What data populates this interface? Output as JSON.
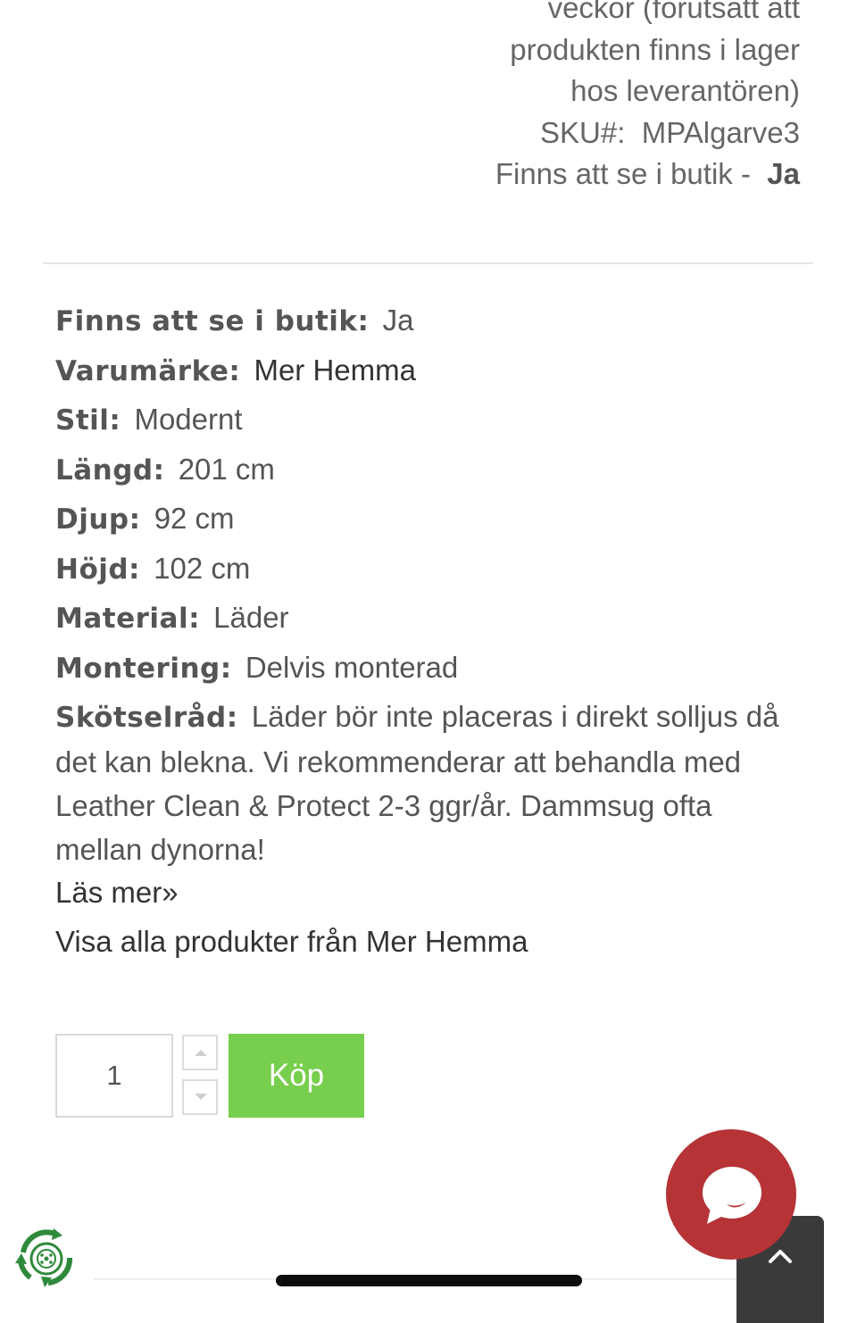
{
  "top_info": {
    "line1": "veckor (förutsatt att",
    "line2": "produkten finns i lager",
    "line3": "hos leverantören)",
    "sku_label": "SKU#:",
    "sku_value": "MPAlgarve3",
    "store_label": "Finns att se i butik -",
    "store_value": "Ja"
  },
  "specs": [
    {
      "label": "Finns att se i butik:",
      "value": "Ja"
    },
    {
      "label": "Varumärke:",
      "value": "Mer Hemma"
    },
    {
      "label": "Stil:",
      "value": "Modernt"
    },
    {
      "label": "Längd:",
      "value": "201 cm"
    },
    {
      "label": "Djup:",
      "value": "92 cm"
    },
    {
      "label": "Höjd:",
      "value": "102 cm"
    },
    {
      "label": "Material:",
      "value": "Läder"
    },
    {
      "label": "Montering:",
      "value": "Delvis monterad"
    }
  ],
  "care": {
    "label": "Skötselråd:",
    "value": "Läder bör inte placeras i direkt solljus då det kan blekna. Vi rekommenderar att behandla med Leather Clean & Protect 2-3 ggr/år. Dammsug ofta mellan dynorna!"
  },
  "links": {
    "read_more": "Läs mer»",
    "all_products": "Visa alla produkter från Mer Hemma"
  },
  "purchase": {
    "quantity": "1",
    "buy_label": "Köp"
  },
  "icons": {
    "stepper_up": "triangle-up-icon",
    "stepper_down": "triangle-down-icon",
    "chat": "chat-bubble-icon",
    "scroll_top": "chevron-up-icon",
    "recycle": "recycle-badge-icon"
  },
  "colors": {
    "buy_button": "#77cf4d",
    "chat_button": "#b63336",
    "scroll_top": "#3a3a3a",
    "recycle_green": "#2e8a3a"
  }
}
